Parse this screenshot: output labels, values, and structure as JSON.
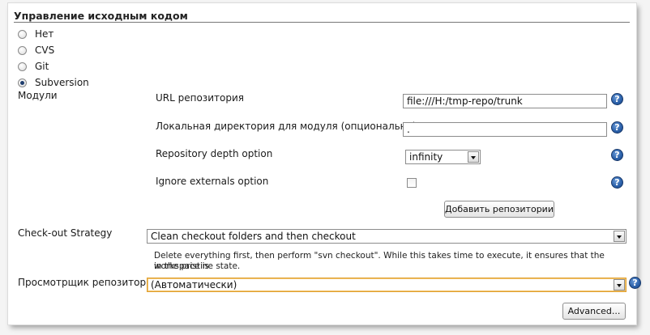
{
  "section": {
    "title": "Управление исходным кодом"
  },
  "scm_options": [
    {
      "label": "Нет",
      "checked": false
    },
    {
      "label": "CVS",
      "checked": false
    },
    {
      "label": "Git",
      "checked": false
    },
    {
      "label": "Subversion",
      "checked": true
    }
  ],
  "modules": {
    "label": "Модули",
    "repo_url_label": "URL репозитория",
    "repo_url_value": "file:///H:/tmp-repo/trunk",
    "local_dir_label": "Локальная директория для модуля (опционально)",
    "local_dir_value": ".",
    "depth_label": "Repository depth option",
    "depth_value": "infinity",
    "ignore_externals_label": "Ignore externals option",
    "ignore_externals_checked": false,
    "add_repo_button": "Добавить репозитории"
  },
  "checkout": {
    "label": "Check-out Strategy",
    "value": "Clean checkout folders and then checkout",
    "description_line1": "Delete everything first, then perform \"svn checkout\". While this takes time to execute, it ensures that the workspace is",
    "description_line2": "in the pristine state."
  },
  "browser": {
    "label": "Просмотрщик репозитория",
    "value": "(Автоматически)"
  },
  "advanced_button": "Advanced...",
  "help_glyph": "?"
}
